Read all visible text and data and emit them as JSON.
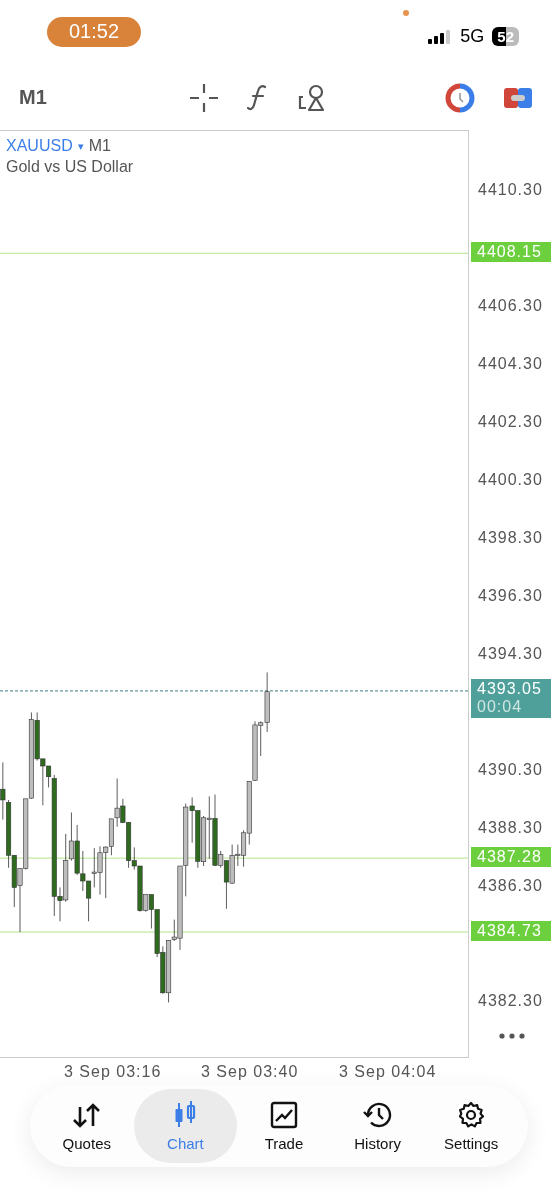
{
  "status_bar": {
    "time": "01:52",
    "network": "5G",
    "battery": "52"
  },
  "toolbar": {
    "timeframe": "M1"
  },
  "chart": {
    "symbol": "XAUUSD",
    "symbol_caret": "▾",
    "timeframe": "M1",
    "description": "Gold vs US Dollar",
    "price_ticks": [
      "4410.30",
      "4406.30",
      "4404.30",
      "4402.30",
      "4400.30",
      "4398.30",
      "4396.30",
      "4394.30",
      "4390.30",
      "4388.30",
      "4386.30",
      "4382.30"
    ],
    "levels": [
      {
        "kind": "level",
        "label": "4408.15"
      },
      {
        "kind": "current",
        "label": "4393.05",
        "timer": "00:04"
      },
      {
        "kind": "level",
        "label": "4387.28"
      },
      {
        "kind": "level",
        "label": "4384.73"
      }
    ],
    "time_labels": [
      "3 Sep 03:16",
      "3 Sep 03:40",
      "3 Sep 04:04"
    ]
  },
  "nav": [
    {
      "kind": "quotes",
      "label": "Quotes",
      "selected": false
    },
    {
      "kind": "chart",
      "label": "Chart",
      "selected": true
    },
    {
      "kind": "trade",
      "label": "Trade",
      "selected": false
    },
    {
      "kind": "history",
      "label": "History",
      "selected": false
    },
    {
      "kind": "settings",
      "label": "Settings",
      "selected": false
    }
  ]
}
